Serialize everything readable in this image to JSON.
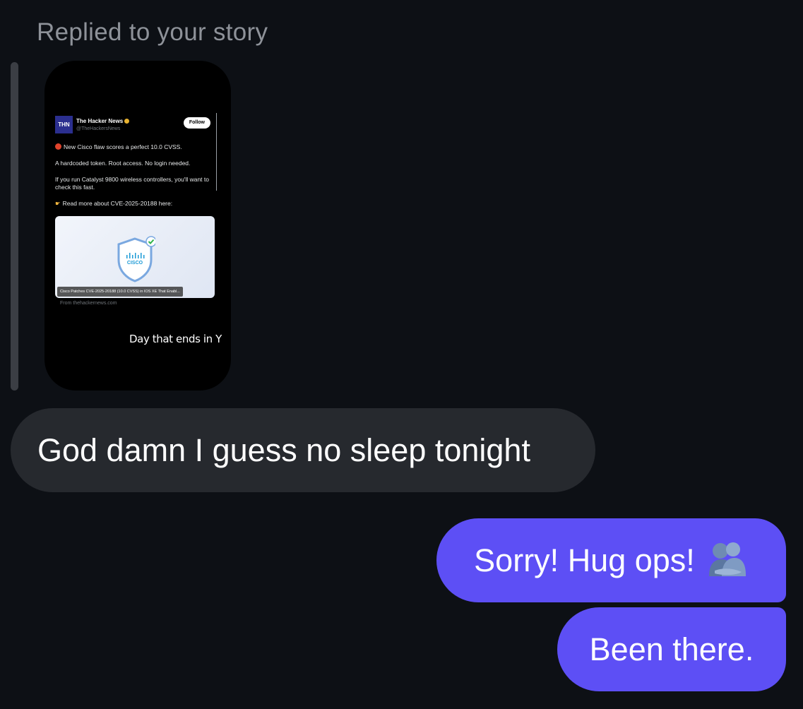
{
  "thread": {
    "reply_label": "Replied to your story"
  },
  "story": {
    "caption": "Day that ends in Y",
    "tweet": {
      "logo_text": "THN",
      "account_name": "The Hacker News",
      "handle": "@TheHackersNews",
      "follow_label": "Follow",
      "line1": "New Cisco flaw scores a perfect 10.0 CVSS.",
      "line2": "A hardcoded token. Root access. No login needed.",
      "line3": "If you run Catalyst 9800 wireless controllers, you'll want to check this fast.",
      "line4": "Read more about CVE-2025-20188 here:",
      "card_brand": "CISCO",
      "card_caption": "Cisco Patches CVE-2025-20188 (10.0 CVSS) in IOS XE That Enabl...",
      "from_line": "From thehackernews.com"
    }
  },
  "messages": {
    "incoming_text": "God damn I guess no sleep tonight",
    "outgoing_1_text": "Sorry! Hug ops!",
    "outgoing_2_text": "Been there."
  },
  "colors": {
    "background": "#0d1015",
    "incoming_bubble": "#26292e",
    "outgoing_bubble": "#5d4ff5"
  },
  "icons": {
    "hug": "people-hugging-icon",
    "verified": "verified-badge-icon",
    "shield": "shield-check-icon"
  }
}
